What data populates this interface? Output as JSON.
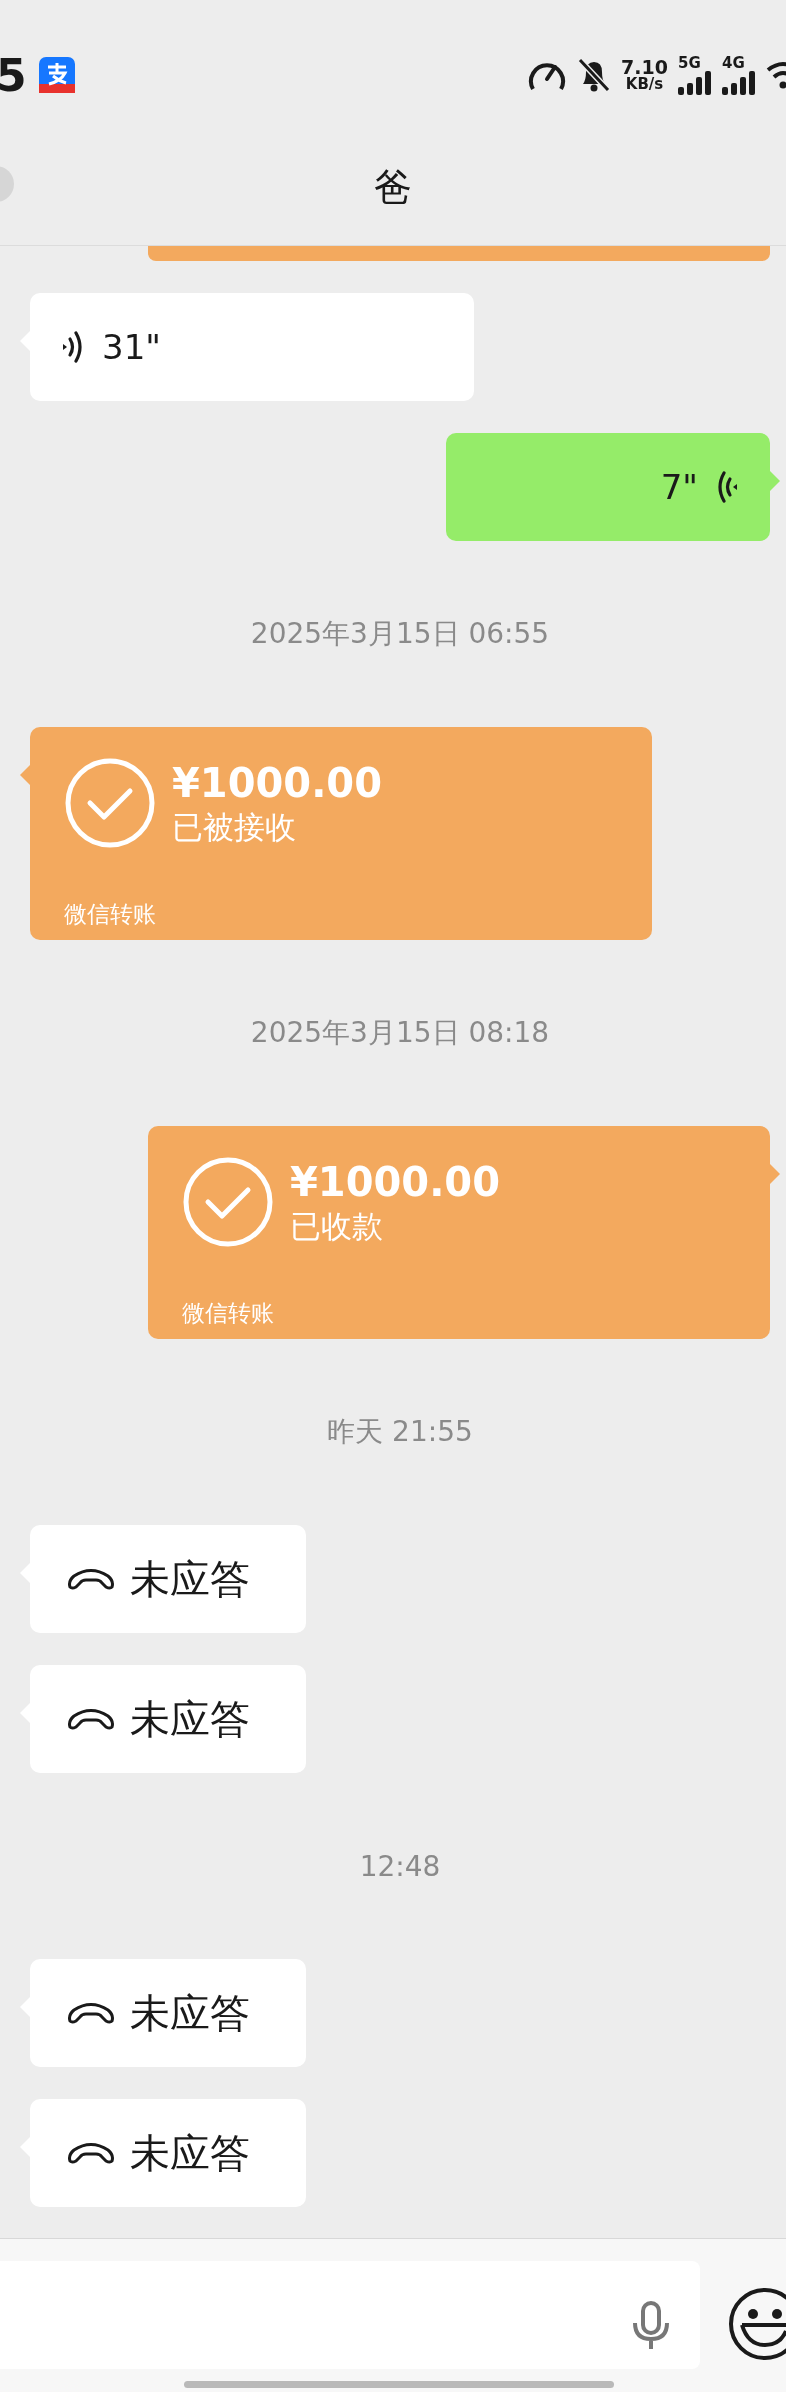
{
  "status_bar": {
    "time": "5",
    "net_speed": "7.10",
    "net_unit": "KB/s",
    "signals": [
      "5G",
      "4G"
    ]
  },
  "header": {
    "title": "爸"
  },
  "messages": [
    {
      "kind": "transfer_edge"
    },
    {
      "kind": "voice",
      "sent": false,
      "duration": "31\""
    },
    {
      "kind": "voice",
      "sent": true,
      "duration": "7\""
    },
    {
      "kind": "time",
      "text": "2025年3月15日 06:55"
    },
    {
      "kind": "transfer",
      "sent": false,
      "amount": "¥1000.00",
      "status": "已被接收",
      "label": "微信转账"
    },
    {
      "kind": "time",
      "text": "2025年3月15日 08:18"
    },
    {
      "kind": "transfer",
      "sent": true,
      "amount": "¥1000.00",
      "status": "已收款",
      "label": "微信转账"
    },
    {
      "kind": "time",
      "text": "昨天 21:55"
    },
    {
      "kind": "call",
      "sent": false,
      "text": "未应答"
    },
    {
      "kind": "call",
      "sent": false,
      "text": "未应答"
    },
    {
      "kind": "time",
      "text": "12:48"
    },
    {
      "kind": "call",
      "sent": false,
      "text": "未应答"
    },
    {
      "kind": "call",
      "sent": false,
      "text": "未应答"
    }
  ]
}
